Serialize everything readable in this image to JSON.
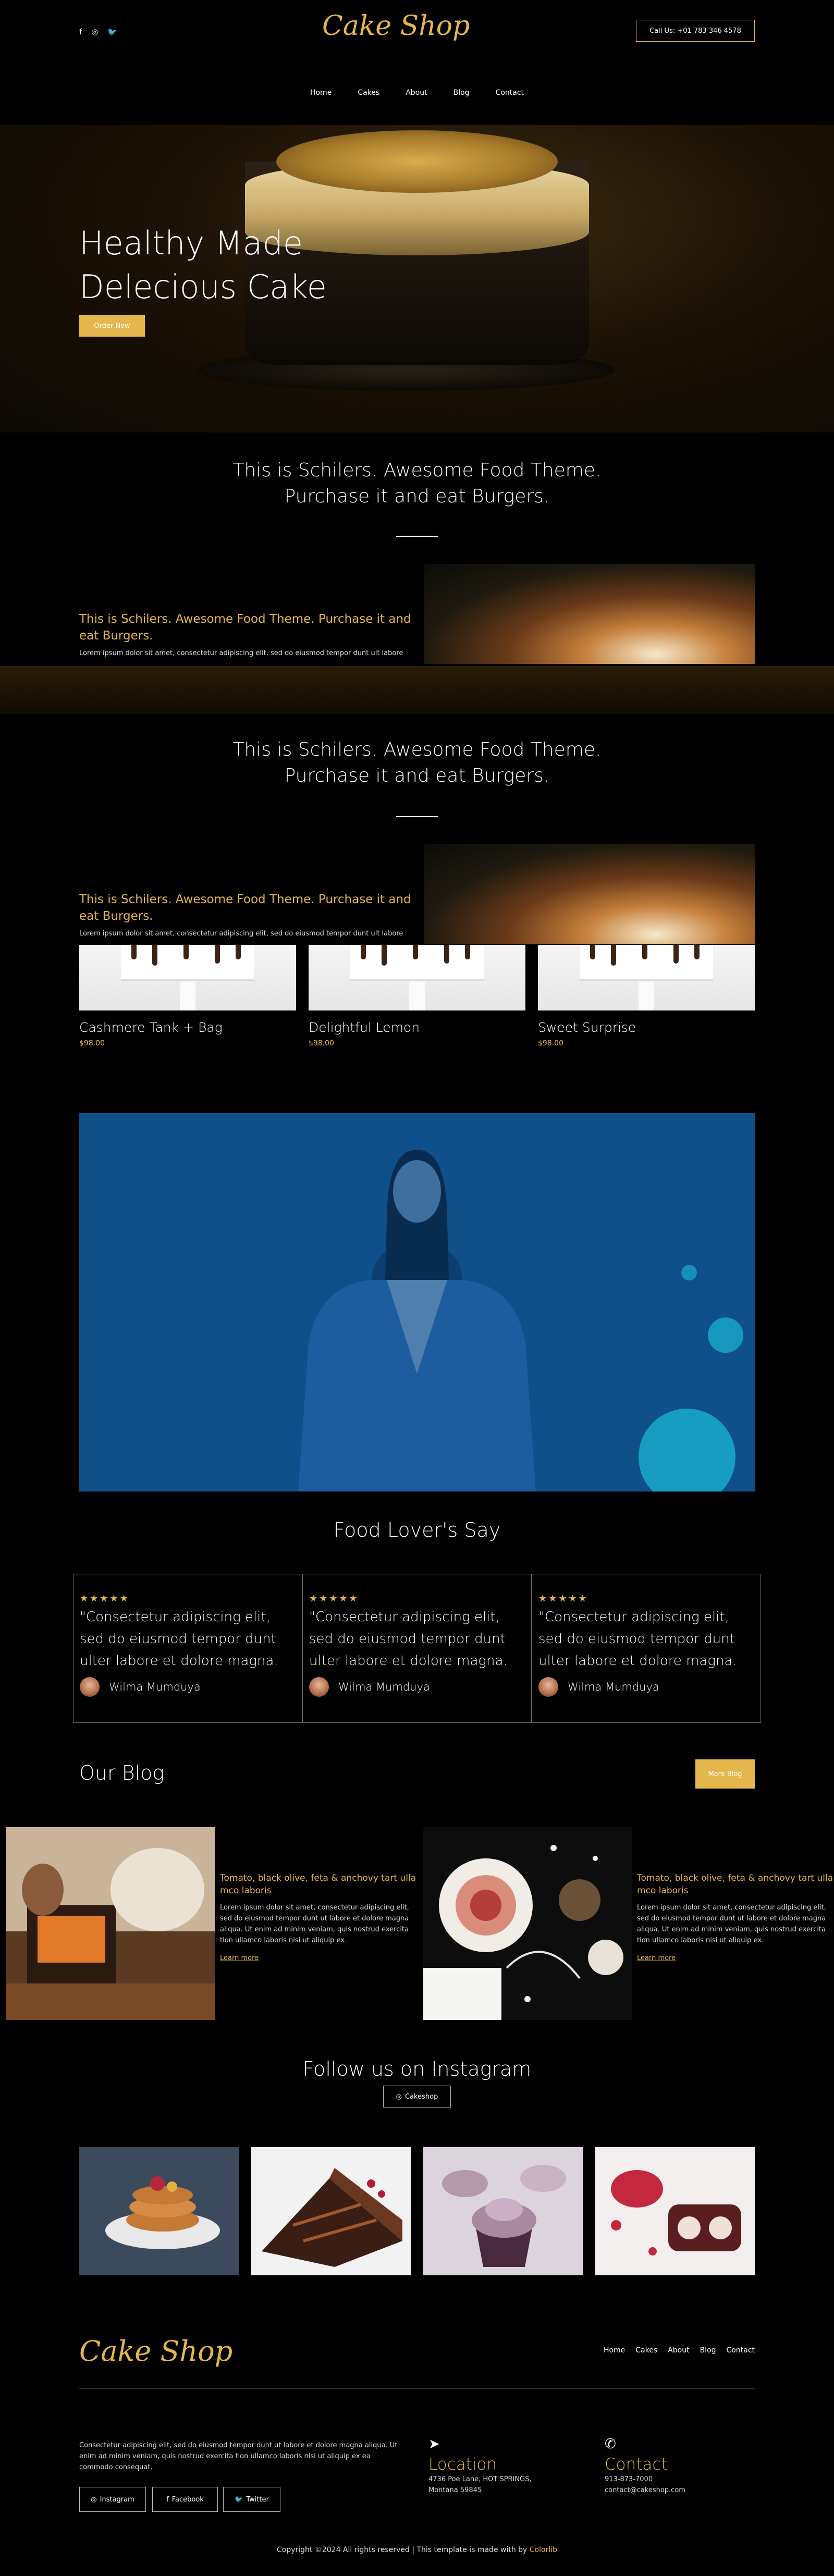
{
  "header": {
    "logo": "Cake Shop",
    "call_button": "Call Us: +01 783 346 4578",
    "social_icons": [
      "facebook-icon",
      "instagram-icon",
      "twitter-icon"
    ],
    "nav": [
      "Home",
      "Cakes",
      "About",
      "Blog",
      "Contact"
    ]
  },
  "hero": {
    "title_line1": "Healthy Made",
    "title_line2": "Delecious Cake",
    "button": "Order Now"
  },
  "about": {
    "title_line1": "This is Schilers. Awesome Food Theme.",
    "title_line2": "Purchase it and eat Burgers.",
    "row_heading_line1": "This is Schilers. Awesome Food Theme. Purchase it and",
    "row_heading_line2": "eat Burgers.",
    "row_text": "Lorem ipsum dolor sit amet, consectetur adipiscing elit, sed do eiusmod tempor dunt ult labore"
  },
  "products": [
    {
      "name": "Cashmere Tank + Bag",
      "price": "$98.00"
    },
    {
      "name": "Delightful Lemon",
      "price": "$98.00"
    },
    {
      "name": "Sweet Surprise",
      "price": "$98.00"
    }
  ],
  "testimonials": {
    "title": "Food Lover's Say",
    "stars": "★★★★★",
    "items": [
      {
        "quote": "\"Consectetur adipiscing elit, sed do eiusmod tempor dunt ulter labore et dolore magna.",
        "author": "Wilma Mumduya"
      },
      {
        "quote": "\"Consectetur adipiscing elit, sed do eiusmod tempor dunt ulter labore et dolore magna.",
        "author": "Wilma Mumduya"
      },
      {
        "quote": "\"Consectetur adipiscing elit, sed do eiusmod tempor dunt ulter labore et dolore magna.",
        "author": "Wilma Mumduya"
      }
    ]
  },
  "blog": {
    "title": "Our Blog",
    "more_button": "More Blog",
    "posts": [
      {
        "heading": "Tomato, black olive, feta & anchovy tart ulla mco laboris",
        "text": "Lorem ipsum dolor sit amet, consectetur adipiscing elit, sed do eiusmod tempor dunt ut labore et dolore magna aliqua. Ut enim ad minim veniam, quis nostrud exercita tion ullamco laboris nisi ut aliquip ex.",
        "link": "Learn more"
      },
      {
        "heading": "Tomato, black olive, feta & anchovy tart ulla mco laboris",
        "text": "Lorem ipsum dolor sit amet, consectetur adipiscing elit, sed do eiusmod tempor dunt ut labore et dolore magna aliqua. Ut enim ad minim veniam, quis nostrud exercita tion ullamco laboris nisi ut aliquip ex.",
        "link": "Learn more"
      }
    ]
  },
  "instagram": {
    "title": "Follow us on Instagram",
    "button": "Cakeshop"
  },
  "footer": {
    "logo": "Cake Shop",
    "nav": [
      "Home",
      "Cakes",
      "About",
      "Blog",
      "Contact"
    ],
    "about_text": "Consectetur adipiscing elit, sed do eiusmod tempor dunt ut labore et dolore magna aliqua. Ut enim ad minim veniam, quis nostrud exercita tion ullamco laboris nisi ut aliquip ex ea commodo consequat.",
    "social": [
      "Instagram",
      "Facebook",
      "Twitter"
    ],
    "location_title": "Location",
    "location_line1": "4736 Poe Lane, HOT SPRINGS,",
    "location_line2": "Montana 59845",
    "contact_title": "Contact",
    "contact_phone": "913-873-7000",
    "contact_email": "contact@cakeshop.com",
    "copyright": "Copyright ©2024 All rights reserved | This template is made with by",
    "copyright_brand": "Colorlib"
  },
  "colors": {
    "accent": "#e4b64b",
    "background": "#000000",
    "banner": "#0f4f8a"
  }
}
